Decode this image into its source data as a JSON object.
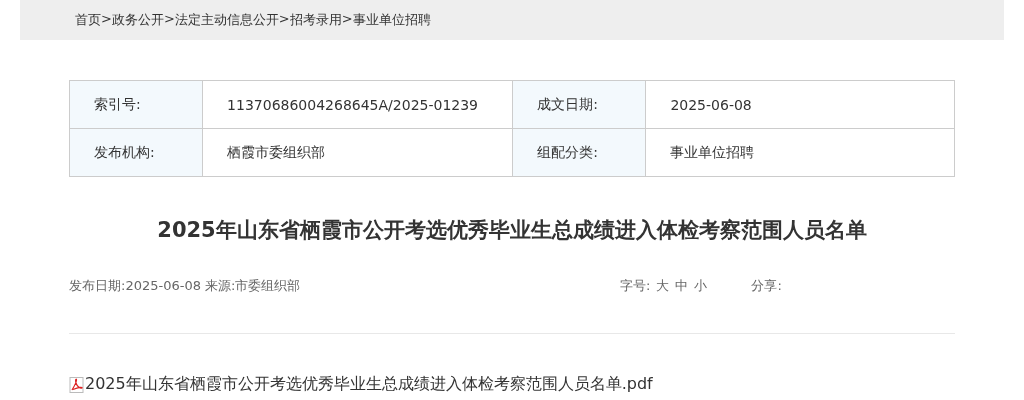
{
  "breadcrumb": {
    "separator": ">",
    "items": [
      "首页",
      "政务公开",
      "法定主动信息公开",
      "招考录用",
      "事业单位招聘"
    ]
  },
  "info_table": [
    [
      {
        "label": "索引号:",
        "value": "11370686004268645A/2025-01239"
      },
      {
        "label": "成文日期:",
        "value": "2025-06-08"
      }
    ],
    [
      {
        "label": "发布机构:",
        "value": "栖霞市委组织部"
      },
      {
        "label": "组配分类:",
        "value": "事业单位招聘"
      }
    ]
  ],
  "title": "2025年山东省栖霞市公开考选优秀毕业生总成绩进入体检考察范围人员名单",
  "meta": {
    "publish": "发布日期:2025-06-08 来源:市委组织部",
    "font_size_label": "字号:",
    "font_sizes": [
      "大",
      "中",
      "小"
    ],
    "share_label": "分享:"
  },
  "attachments": [
    {
      "kind": "pdf",
      "name": "2025年山东省栖霞市公开考选优秀毕业生总成绩进入体检考察范围人员名单.pdf"
    }
  ]
}
